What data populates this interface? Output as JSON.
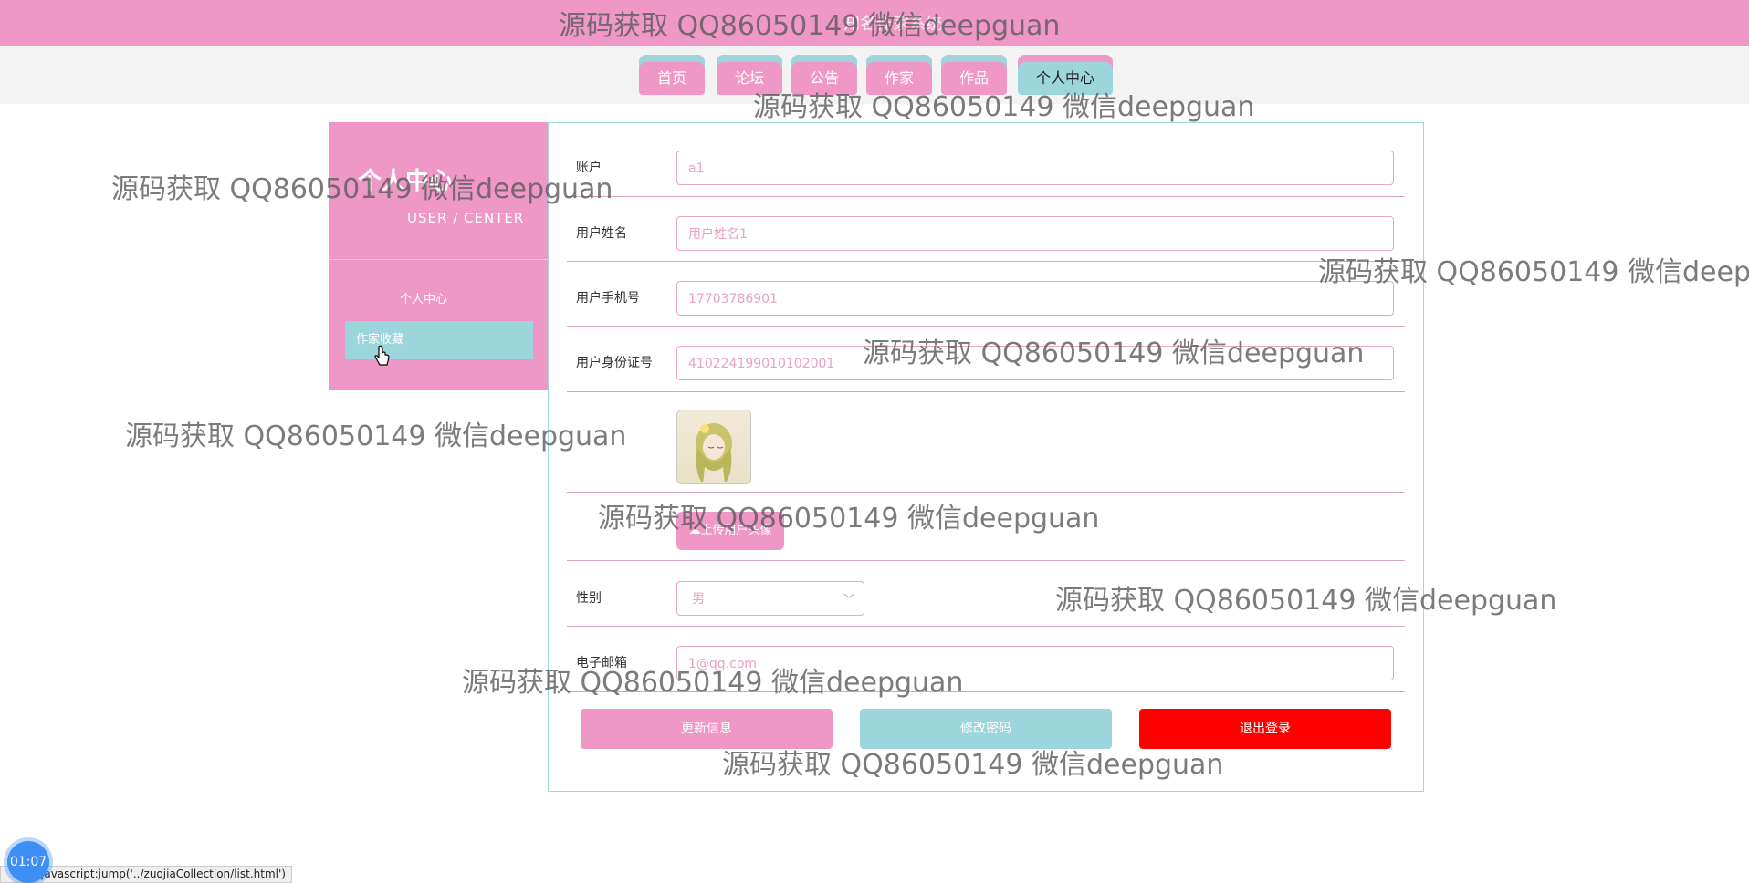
{
  "header": {
    "site_title": "知名作家系统"
  },
  "nav": [
    {
      "label": "首页"
    },
    {
      "label": "论坛"
    },
    {
      "label": "公告"
    },
    {
      "label": "作家"
    },
    {
      "label": "作品"
    },
    {
      "label": "个人中心",
      "active": true
    }
  ],
  "sidebar": {
    "title": "个人中心",
    "subtitle": "USER / CENTER",
    "items": [
      {
        "label": "个人中心"
      },
      {
        "label": "作家收藏",
        "active": true
      }
    ]
  },
  "form": {
    "account_label": "账户",
    "account_value": "a1",
    "name_label": "用户姓名",
    "name_value": "用户姓名1",
    "phone_label": "用户手机号",
    "phone_value": "17703786901",
    "id_label": "用户身份证号",
    "id_value": "410224199010102001",
    "upload_label": "上传用户头像",
    "gender_label": "性别",
    "gender_value": "男",
    "email_label": "电子邮箱",
    "email_value": "1@qq.com"
  },
  "actions": {
    "update": "更新信息",
    "change_password": "修改密码",
    "logout": "退出登录"
  },
  "watermark": "源码获取 QQ86050149 微信deepguan",
  "overlay": {
    "timer": "01:07",
    "status_url": "javascript:jump('../zuojiaCollection/list.html')"
  },
  "colors": {
    "pink": "#ef98c6",
    "teal": "#9dd5dd",
    "red": "#ff0000"
  }
}
